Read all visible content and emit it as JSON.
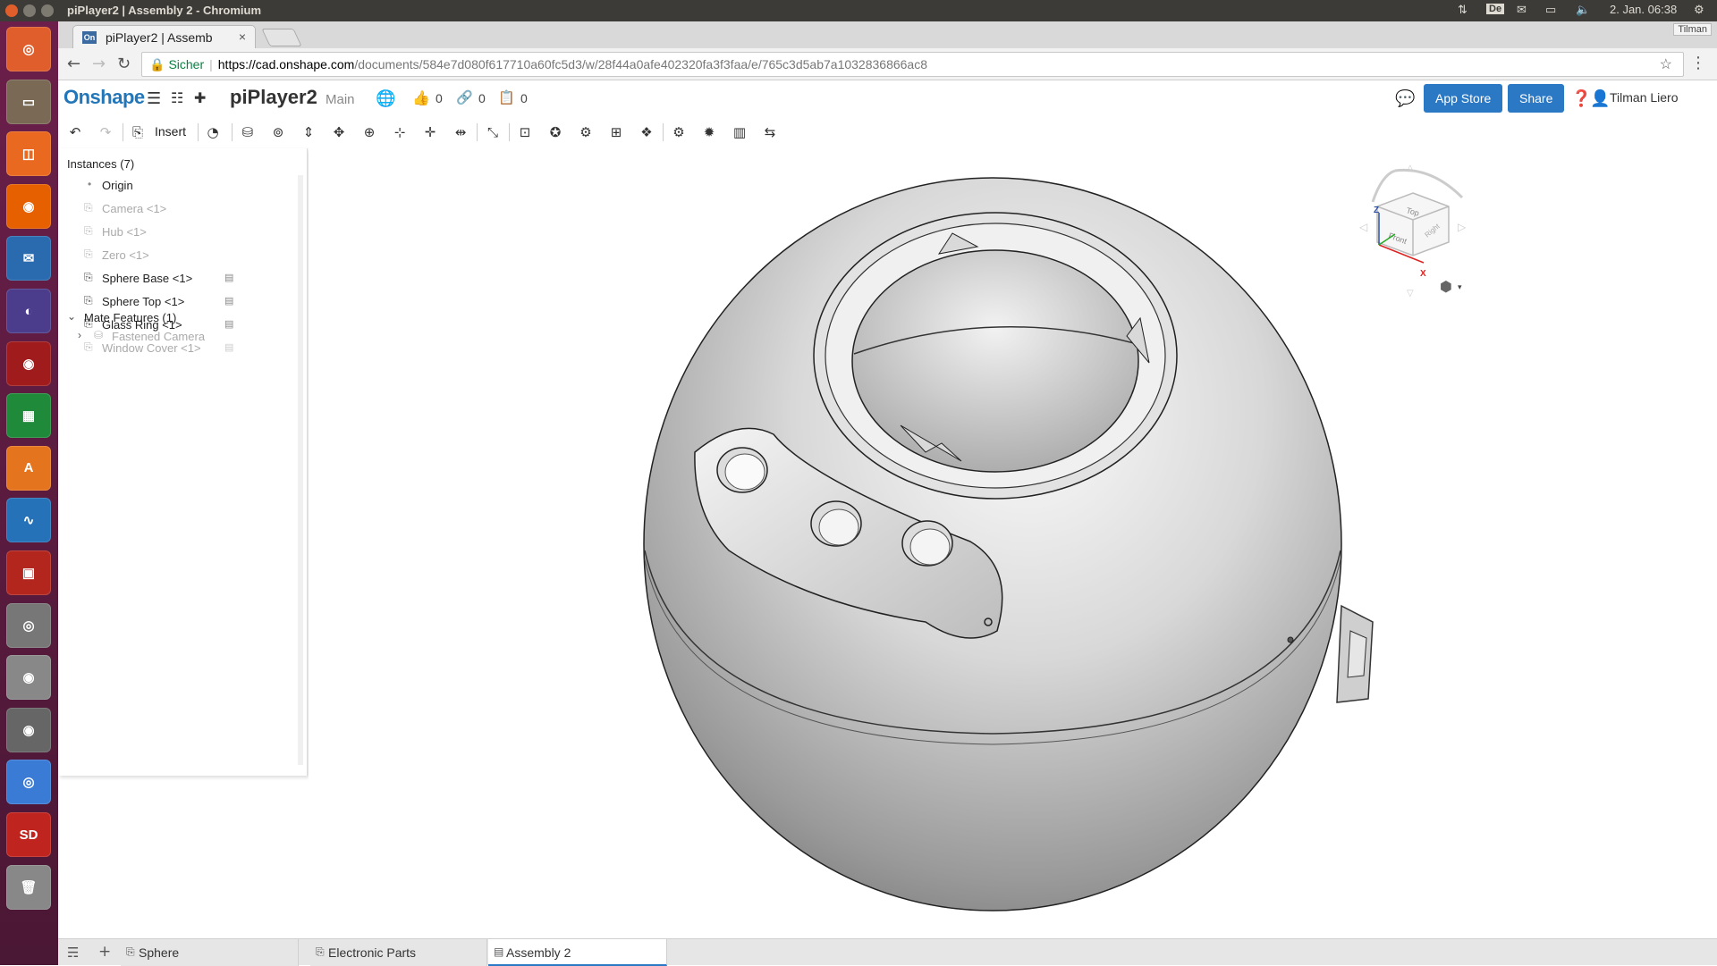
{
  "os_bar": {
    "window_title": "piPlayer2 | Assembly 2 - Chromium",
    "keyboard_layout": "De",
    "clock": "2. Jan. 06:38",
    "user_tooltip": "Tilman"
  },
  "launcher": {
    "items": [
      {
        "name": "dash",
        "glyph": "◎",
        "color": "#e05e2c"
      },
      {
        "name": "files",
        "glyph": "▭",
        "color": "#7a6a55"
      },
      {
        "name": "workspaces",
        "glyph": "◫",
        "color": "#e8691f"
      },
      {
        "name": "firefox",
        "glyph": "◉",
        "color": "#e66000"
      },
      {
        "name": "thunderbird",
        "glyph": "✉",
        "color": "#2a6bb0"
      },
      {
        "name": "eclipse",
        "glyph": "◐",
        "color": "#4b3c8c"
      },
      {
        "name": "app-red",
        "glyph": "◉",
        "color": "#a01c1c"
      },
      {
        "name": "calc",
        "glyph": "▦",
        "color": "#1f8a3a"
      },
      {
        "name": "software-center",
        "glyph": "A",
        "color": "#e5741f"
      },
      {
        "name": "monitor",
        "glyph": "∿",
        "color": "#2672b8"
      },
      {
        "name": "qr-app",
        "glyph": "▣",
        "color": "#b3261e"
      },
      {
        "name": "dvd",
        "glyph": "◎",
        "color": "#777"
      },
      {
        "name": "disc",
        "glyph": "◉",
        "color": "#888"
      },
      {
        "name": "webcam",
        "glyph": "◉",
        "color": "#666"
      },
      {
        "name": "chromium",
        "glyph": "◎",
        "color": "#3a7bd5"
      },
      {
        "name": "sd-card",
        "glyph": "SD",
        "color": "#c0241e"
      },
      {
        "name": "trash",
        "glyph": "🗑",
        "color": "#888"
      }
    ]
  },
  "browser": {
    "tab_title": "piPlayer2 | Assemb",
    "tab_close": "×",
    "tab_favicon": "On",
    "security": "Sicher",
    "url_host": "https://cad.onshape.com",
    "url_path": "/documents/584e7d080f617710a60fc5d3/w/28f44a0afe402320fa3f3faa/e/765c3d5ab7a1032836866ac8"
  },
  "header": {
    "logo": "Onshape",
    "doc_name": "piPlayer2",
    "branch": "Main",
    "likes": "0",
    "links": "0",
    "copies": "0",
    "app_store": "App Store",
    "share": "Share",
    "user": "Tilman Liero"
  },
  "toolbar": {
    "insert": "Insert"
  },
  "instances": {
    "header": "Instances (7)",
    "items": [
      {
        "label": "Origin",
        "dim": false,
        "icon": "origin-icon"
      },
      {
        "label": "Camera <1>",
        "dim": true,
        "icon": "part-icon"
      },
      {
        "label": "Hub <1>",
        "dim": true,
        "icon": "part-icon"
      },
      {
        "label": "Zero <1>",
        "dim": true,
        "icon": "part-icon"
      },
      {
        "label": "Sphere Base <1>",
        "dim": false,
        "icon": "part-icon"
      },
      {
        "label": "Sphere Top <1>",
        "dim": false,
        "icon": "part-icon"
      },
      {
        "label": "Glass Ring <1>",
        "dim": false,
        "icon": "part-icon"
      },
      {
        "label": "Window Cover <1>",
        "dim": true,
        "icon": "part-icon"
      }
    ],
    "mate_header": "Mate Features (1)",
    "mate_item": "Fastened Camera"
  },
  "viewcube": {
    "top": "Top",
    "front": "Front",
    "right": "Right",
    "z": "Z",
    "x": "X"
  },
  "bottom_tabs": [
    {
      "label": "Sphere",
      "active": false
    },
    {
      "label": "Electronic Parts",
      "active": false
    },
    {
      "label": "Assembly 2",
      "active": true
    }
  ]
}
